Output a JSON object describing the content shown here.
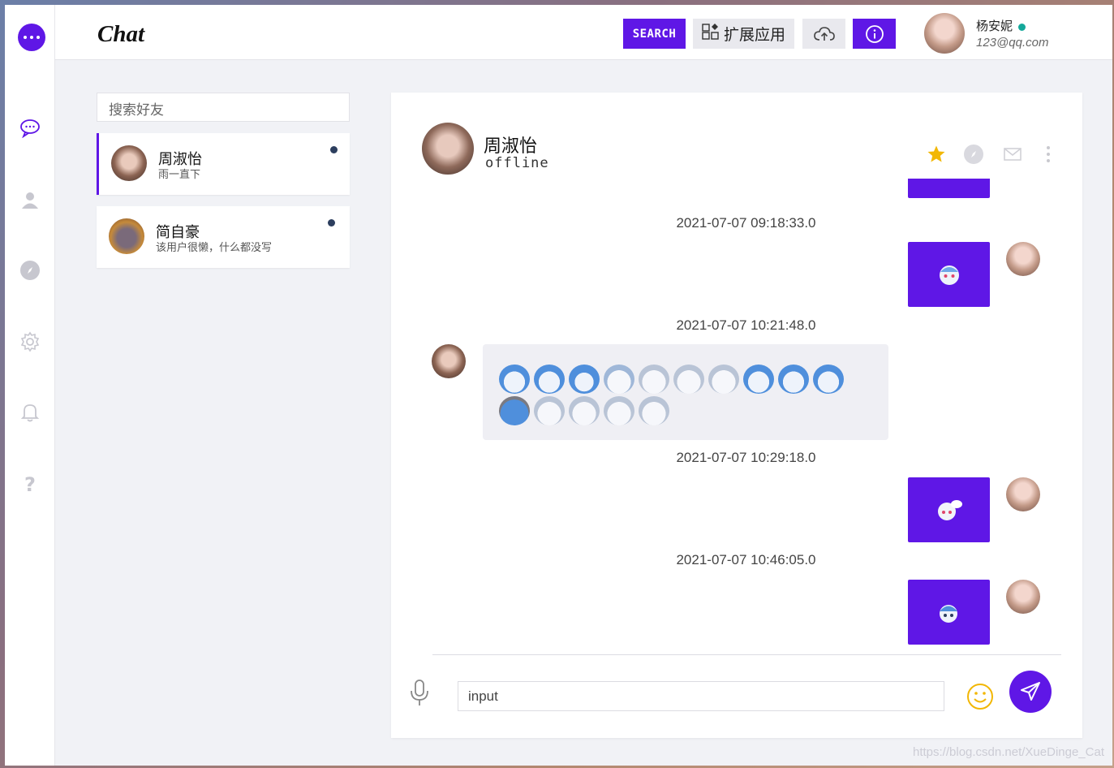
{
  "header": {
    "brand": "Chat",
    "search_label": "SEARCH",
    "extensions_label": "扩展应用",
    "user_name": "杨安妮",
    "user_email": "123@qq.com"
  },
  "friends": {
    "search_placeholder": "搜索好友",
    "items": [
      {
        "name": "周淑怡",
        "signature": "雨一直下"
      },
      {
        "name": "简自豪",
        "signature": "该用户很懒，什么都没写"
      }
    ]
  },
  "chat": {
    "name": "周淑怡",
    "status": "offline",
    "timestamps": [
      "2021-07-07 09:18:33.0",
      "2021-07-07 10:21:48.0",
      "2021-07-07 10:29:18.0",
      "2021-07-07 10:46:05.0"
    ],
    "input_placeholder": "input"
  },
  "colors": {
    "accent": "#5f17e6",
    "online": "#14a89a",
    "star": "#f2b705"
  },
  "watermark": "https://blog.csdn.net/XueDinge_Cat"
}
